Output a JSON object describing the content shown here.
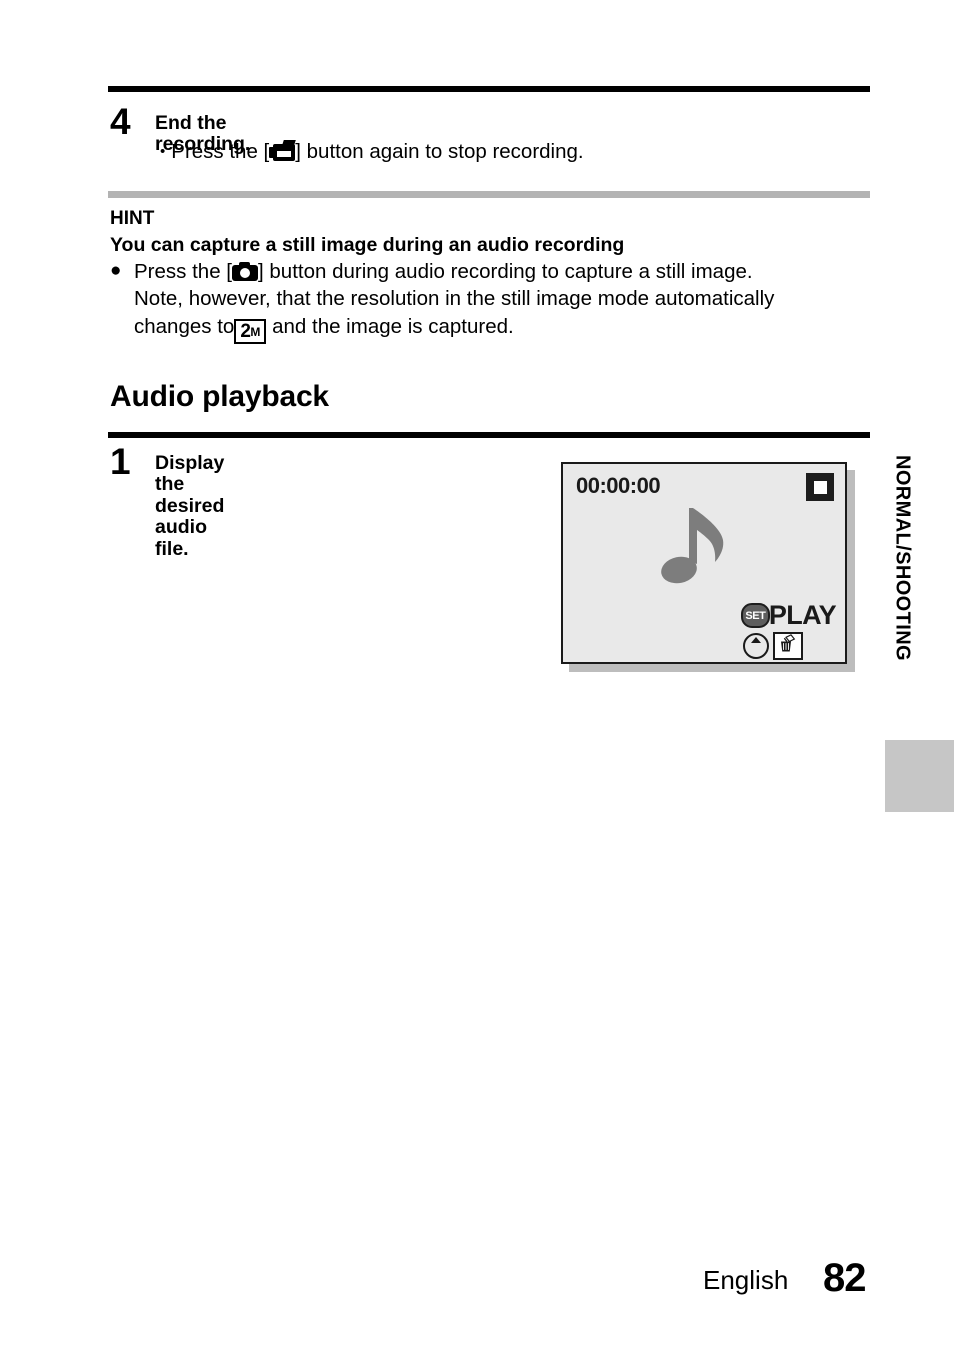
{
  "page": {
    "footer_language": "English",
    "footer_page_number": "82",
    "side_tab_label": "NORMAL/SHOOTING"
  },
  "step4": {
    "number": "4",
    "title": "End the recording.",
    "bullet_marker": "•",
    "bullet_before": "Press the [",
    "bullet_icon": "camcorder-icon",
    "bullet_after": "] button again to stop recording."
  },
  "hint": {
    "label": "HINT",
    "subtitle": "You can capture a still image during an audio recording",
    "bullet_marker": "●",
    "line1_before": "Press the [",
    "line1_icon": "camera-icon",
    "line1_after": "] button during audio recording to capture a still image.",
    "line2": "Note, however, that the resolution in the still image mode automatically",
    "line3_before": "changes to",
    "badge_number": "2",
    "badge_unit": "M",
    "line3_after": "and the image is captured."
  },
  "section": {
    "heading": "Audio playback"
  },
  "step1": {
    "number": "1",
    "title": "Display the desired audio file."
  },
  "lcd": {
    "timecode": "00:00:00",
    "stop_icon": "stop-icon",
    "note_icon": "music-note-icon",
    "set_chip_label": "SET",
    "play_label": "PLAY",
    "up_button_icon": "up-arrow-button-icon",
    "delete_icon": "trash-delete-icon",
    "screen_bg": "#e9e9e9",
    "note_color": "#7d7d7d"
  }
}
